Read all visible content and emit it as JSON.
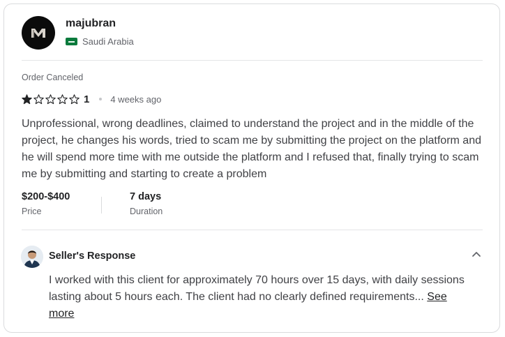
{
  "reviewer": {
    "username": "majubran",
    "country": "Saudi Arabia"
  },
  "review": {
    "order_status": "Order Canceled",
    "rating": 1,
    "rating_max": 5,
    "rating_label": "1",
    "time_ago": "4 weeks ago",
    "text": "Unprofessional, wrong deadlines, claimed to understand the project and in the middle of the project, he changes his words, tried to scam me by submitting the project on the platform and he will spend more time with me outside the platform and I refused that, finally trying to scam me by submitting and starting to create a problem",
    "price_value": "$200-$400",
    "price_label": "Price",
    "duration_value": "7 days",
    "duration_label": "Duration"
  },
  "seller_response": {
    "title": "Seller's Response",
    "text": "I worked with this client for approximately 70 hours over 15 days, with daily sessions lasting about 5 hours each. The client had no clearly defined requirements...",
    "see_more_label": "See more"
  },
  "icons": {
    "reviewer_avatar": "m-logo-icon",
    "flag": "saudi-arabia-flag-icon",
    "star_filled": "star-filled-icon",
    "star_empty": "star-outline-icon",
    "collapse": "chevron-up-icon"
  },
  "colors": {
    "star": "#222325",
    "flag_green": "#0a7a3c",
    "text_primary": "#222325",
    "text_secondary": "#62646a"
  }
}
